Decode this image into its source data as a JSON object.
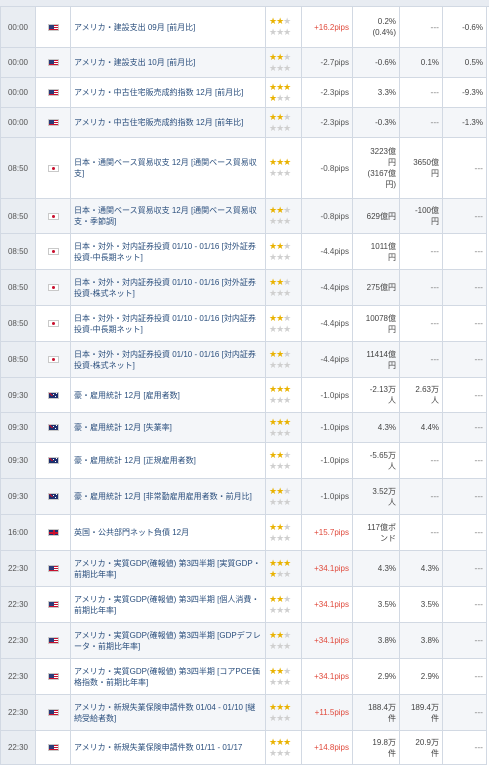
{
  "columns": [
    "time",
    "country",
    "indicator",
    "importance",
    "pips",
    "previous",
    "forecast",
    "actual"
  ],
  "colors": {
    "plus_pips": "#e04a3c",
    "star_on": "#e9b200",
    "star_off": "#cfcfcf",
    "name": "#2b4f7d"
  },
  "rows": [
    {
      "time": "00:00",
      "flag": "us",
      "name": "アメリカ・建設支出 09月 [前月比]",
      "stars": 2,
      "pips": "+16.2pips",
      "prev": "0.2%\n(0.4%)",
      "fcst": "---",
      "act": "-0.6%"
    },
    {
      "time": "00:00",
      "flag": "us",
      "name": "アメリカ・建設支出 10月 [前月比]",
      "stars": 2,
      "pips": "-2.7pips",
      "prev": "-0.6%",
      "fcst": "0.1%",
      "act": "0.5%"
    },
    {
      "time": "00:00",
      "flag": "us",
      "name": "アメリカ・中古住宅販売成約指数 12月 [前月比]",
      "stars": 4,
      "pips": "-2.3pips",
      "prev": "3.3%",
      "fcst": "---",
      "act": "-9.3%"
    },
    {
      "time": "00:00",
      "flag": "us",
      "name": "アメリカ・中古住宅販売成約指数 12月 [前年比]",
      "stars": 2,
      "pips": "-2.3pips",
      "prev": "-0.3%",
      "fcst": "---",
      "act": "-1.3%"
    },
    {
      "time": "08:50",
      "flag": "jp",
      "name": "日本・通関ベース貿易収支 12月 [通関ベース貿易収支]",
      "stars": 3,
      "pips": "-0.8pips",
      "prev": "3223億\n円\n(3167億\n円)",
      "fcst": "3650億\n円",
      "act": "---"
    },
    {
      "time": "08:50",
      "flag": "jp",
      "name": "日本・通関ベース貿易収支 12月 [通関ベース貿易収支・季節調]",
      "stars": 2,
      "pips": "-0.8pips",
      "prev": "629億円",
      "fcst": "-100億\n円",
      "act": "---"
    },
    {
      "time": "08:50",
      "flag": "jp",
      "name": "日本・対外・対内証券投資 01/10 - 01/16 [対外証券投資-中長期ネット]",
      "stars": 2,
      "pips": "-4.4pips",
      "prev": "1011億\n円",
      "fcst": "---",
      "act": "---"
    },
    {
      "time": "08:50",
      "flag": "jp",
      "name": "日本・対外・対内証券投資 01/10 - 01/16 [対外証券投資-株式ネット]",
      "stars": 2,
      "pips": "-4.4pips",
      "prev": "275億円",
      "fcst": "---",
      "act": "---"
    },
    {
      "time": "08:50",
      "flag": "jp",
      "name": "日本・対外・対内証券投資 01/10 - 01/16 [対内証券投資-中長期ネット]",
      "stars": 2,
      "pips": "-4.4pips",
      "prev": "10078億\n円",
      "fcst": "---",
      "act": "---"
    },
    {
      "time": "08:50",
      "flag": "jp",
      "name": "日本・対外・対内証券投資 01/10 - 01/16 [対内証券投資-株式ネット]",
      "stars": 2,
      "pips": "-4.4pips",
      "prev": "11414億\n円",
      "fcst": "---",
      "act": "---"
    },
    {
      "time": "09:30",
      "flag": "au",
      "name": "豪・雇用統計 12月 [雇用者数]",
      "stars": 3,
      "pips": "-1.0pips",
      "prev": "-2.13万\n人",
      "fcst": "2.63万\n人",
      "act": "---"
    },
    {
      "time": "09:30",
      "flag": "au",
      "name": "豪・雇用統計 12月 [失業率]",
      "stars": 3,
      "pips": "-1.0pips",
      "prev": "4.3%",
      "fcst": "4.4%",
      "act": "---"
    },
    {
      "time": "09:30",
      "flag": "au",
      "name": "豪・雇用統計 12月 [正規雇用者数]",
      "stars": 2,
      "pips": "-1.0pips",
      "prev": "-5.65万\n人",
      "fcst": "---",
      "act": "---"
    },
    {
      "time": "09:30",
      "flag": "au",
      "name": "豪・雇用統計 12月 [非常勤雇用雇用者数・前月比]",
      "stars": 2,
      "pips": "-1.0pips",
      "prev": "3.52万\n人",
      "fcst": "---",
      "act": "---"
    },
    {
      "time": "16:00",
      "flag": "gb",
      "name": "英国・公共部門ネット負債 12月",
      "stars": 2,
      "pips": "+15.7pips",
      "prev": "117億ポ\nンド",
      "fcst": "---",
      "act": "---"
    },
    {
      "time": "22:30",
      "flag": "us",
      "name": "アメリカ・実質GDP(確報値) 第3四半期 [実質GDP・前期比年率]",
      "stars": 4,
      "pips": "+34.1pips",
      "prev": "4.3%",
      "fcst": "4.3%",
      "act": "---"
    },
    {
      "time": "22:30",
      "flag": "us",
      "name": "アメリカ・実質GDP(確報値) 第3四半期 [個人消費・前期比年率]",
      "stars": 2,
      "pips": "+34.1pips",
      "prev": "3.5%",
      "fcst": "3.5%",
      "act": "---"
    },
    {
      "time": "22:30",
      "flag": "us",
      "name": "アメリカ・実質GDP(確報値) 第3四半期 [GDPデフレータ・前期比年率]",
      "stars": 2,
      "pips": "+34.1pips",
      "prev": "3.8%",
      "fcst": "3.8%",
      "act": "---"
    },
    {
      "time": "22:30",
      "flag": "us",
      "name": "アメリカ・実質GDP(確報値) 第3四半期 [コアPCE価格指数・前期比年率]",
      "stars": 2,
      "pips": "+34.1pips",
      "prev": "2.9%",
      "fcst": "2.9%",
      "act": "---"
    },
    {
      "time": "22:30",
      "flag": "us",
      "name": "アメリカ・新規失業保険申請件数 01/04 - 01/10 [継続受給者数]",
      "stars": 3,
      "pips": "+11.5pips",
      "prev": "188.4万\n件",
      "fcst": "189.4万\n件",
      "act": "---"
    },
    {
      "time": "22:30",
      "flag": "us",
      "name": "アメリカ・新規失業保険申請件数 01/11 - 01/17",
      "stars": 3,
      "pips": "+14.8pips",
      "prev": "19.8万\n件",
      "fcst": "20.9万\n件",
      "act": "---"
    }
  ]
}
